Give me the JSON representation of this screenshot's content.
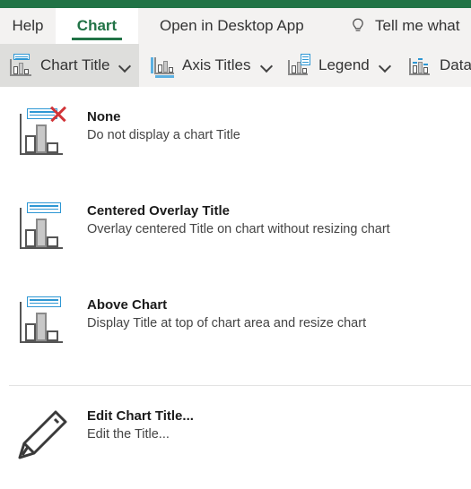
{
  "window": {
    "accent_green": "#217346",
    "ribbon_bg": "#f3f2f1",
    "active_btn_bg": "#dededc",
    "icon_blue": "#2e97d4",
    "icon_red": "#d13438"
  },
  "tabs": [
    {
      "label": "Help",
      "active": false,
      "name": "tab-help"
    },
    {
      "label": "Chart",
      "active": true,
      "name": "tab-chart"
    }
  ],
  "quick_commands": [
    {
      "label": "Open in Desktop App",
      "name": "open-in-desktop-app-button",
      "icon": ""
    },
    {
      "label": "Tell me what",
      "name": "tell-me-search",
      "icon": "lightbulb-icon"
    }
  ],
  "ribbon": {
    "buttons": [
      {
        "label": "Chart Title",
        "icon": "chart-title-icon",
        "has_chevron": true,
        "active": true
      },
      {
        "label": "Axis Titles",
        "icon": "axis-titles-icon",
        "has_chevron": true,
        "active": false
      },
      {
        "label": "Legend",
        "icon": "legend-icon",
        "has_chevron": true,
        "active": false
      },
      {
        "label": "Data",
        "icon": "data-labels-icon",
        "has_chevron": false,
        "active": false
      }
    ]
  },
  "dropdown": {
    "name": "chart-title-dropdown",
    "items": [
      {
        "title": "None",
        "desc": "Do not display a chart Title",
        "icon": "chart-title-none-icon",
        "name": "menu-item-none"
      },
      {
        "title": "Centered Overlay Title",
        "desc": "Overlay centered Title on chart without resizing chart",
        "icon": "chart-title-centered-overlay-icon",
        "name": "menu-item-centered-overlay-title"
      },
      {
        "title": "Above Chart",
        "desc": "Display Title at top of chart area and resize chart",
        "icon": "chart-title-above-chart-icon",
        "name": "menu-item-above-chart"
      },
      {
        "title": "Edit Chart Title...",
        "desc": "Edit the Title...",
        "icon": "pencil-icon",
        "name": "menu-item-edit-chart-title"
      }
    ]
  }
}
